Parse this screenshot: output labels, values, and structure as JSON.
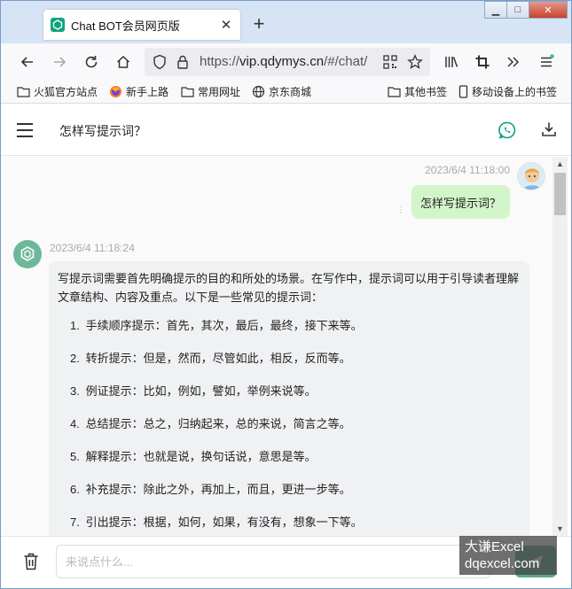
{
  "browser": {
    "tab_title": "Chat BOT会员网页版",
    "tab_close": "✕",
    "new_tab": "+",
    "url_scheme": "https://",
    "url_host": "vip.qdymys.cn",
    "url_path": "/#/chat/",
    "window_buttons": {
      "minimize": "▁",
      "maximize": "□",
      "close": "✕"
    }
  },
  "bookmarks": [
    {
      "label": "火狐官方站点",
      "icon": "folder-icon"
    },
    {
      "label": "新手上路",
      "icon": "firefox-icon"
    },
    {
      "label": "常用网址",
      "icon": "folder-icon"
    },
    {
      "label": "京东商城",
      "icon": "globe-icon"
    }
  ],
  "bookmarks_right": [
    {
      "label": "其他书签",
      "icon": "folder-icon"
    },
    {
      "label": "移动设备上的书签",
      "icon": "mobile-icon"
    }
  ],
  "app": {
    "header_title": "怎样写提示词？",
    "accent_color": "#10a37f"
  },
  "messages": {
    "user": {
      "time": "2023/6/4 11:18:00",
      "text": "怎样写提示词？"
    },
    "bot": {
      "time": "2023/6/4 11:18:24",
      "intro": "写提示词需要首先明确提示的目的和所处的场景。在写作中，提示词可以用于引导读者理解文章结构、内容及重点。以下是一些常见的提示词：",
      "items": [
        {
          "num": "1.",
          "text": "手续顺序提示：首先，其次，最后，最终，接下来等。"
        },
        {
          "num": "2.",
          "text": "转折提示：但是，然而，尽管如此，相反，反而等。"
        },
        {
          "num": "3.",
          "text": "例证提示：比如，例如，譬如，举例来说等。"
        },
        {
          "num": "4.",
          "text": "总结提示：总之，归纳起来，总的来说，简言之等。"
        },
        {
          "num": "5.",
          "text": "解释提示：也就是说，换句话说，意思是等。"
        },
        {
          "num": "6.",
          "text": "补充提示：除此之外，再加上，而且，更进一步等。"
        },
        {
          "num": "7.",
          "text": "引出提示：根据，如何，如果，有没有，想象一下等。"
        }
      ]
    }
  },
  "footer": {
    "input_placeholder": "来说点什么..."
  },
  "watermark": {
    "line1": "大谦Excel",
    "line2": "dqexcel.com"
  }
}
